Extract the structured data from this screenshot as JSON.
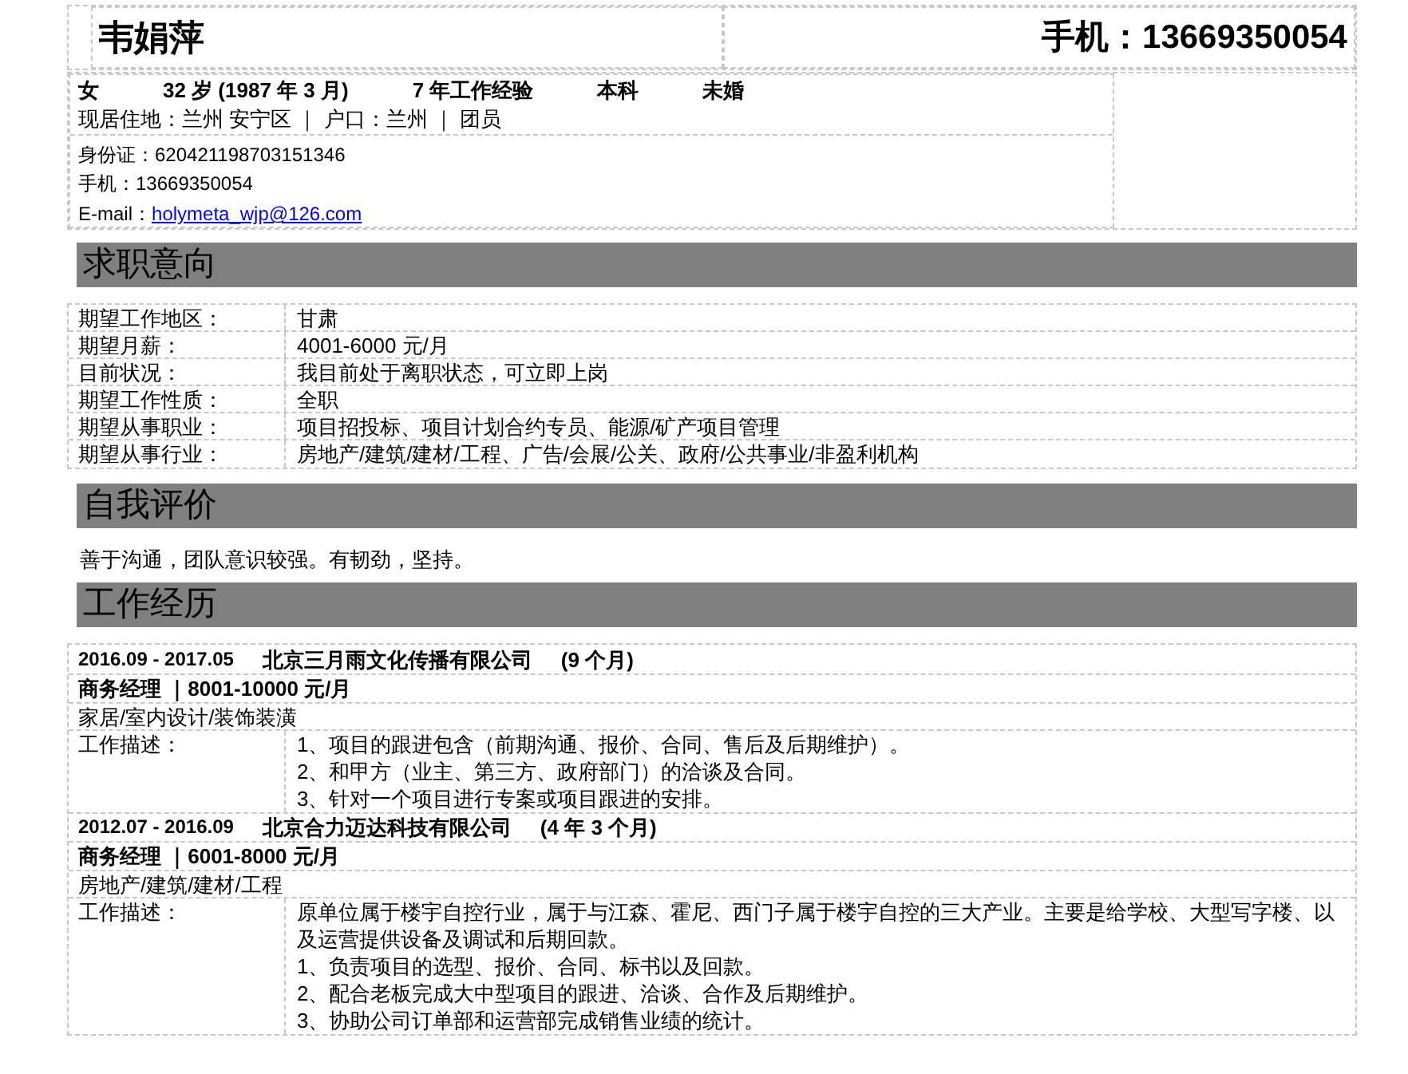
{
  "header": {
    "name": "韦娟萍",
    "phone": "手机：13669350054"
  },
  "profile": {
    "summary": [
      "女",
      "32 岁 (1987 年 3 月)",
      "7 年工作经验",
      "本科",
      "未婚"
    ],
    "residence": "现居住地：兰州 安宁区 ｜ 户口：兰州 ｜ 团员",
    "id_number": "身份证：620421198703151346",
    "mobile": "手机：13669350054",
    "email_label": "E-mail：",
    "email": "holymeta_wjp@126.com"
  },
  "job_intent": {
    "title": "求职意向",
    "rows": [
      {
        "label": "期望工作地区：",
        "value": "甘肃"
      },
      {
        "label": "期望月薪：",
        "value": "4001-6000 元/月"
      },
      {
        "label": "目前状况：",
        "value": "我目前处于离职状态，可立即上岗"
      },
      {
        "label": "期望工作性质：",
        "value": "全职"
      },
      {
        "label": "期望从事职业：",
        "value": "项目招投标、项目计划合约专员、能源/矿产项目管理"
      },
      {
        "label": "期望从事行业：",
        "value": "房地产/建筑/建材/工程、广告/会展/公关、政府/公共事业/非盈利机构"
      }
    ]
  },
  "self_evaluation": {
    "title": "自我评价",
    "text": "善于沟通，团队意识较强。有韧劲，坚持。"
  },
  "work_experience": {
    "title": "工作经历",
    "jobs": [
      {
        "period": "2016.09 - 2017.05",
        "company": "北京三月雨文化传播有限公司",
        "duration": "(9 个月)",
        "position": "商务经理 ｜8001-10000 元/月",
        "industry": "家居/室内设计/装饰装潢",
        "description_label": "工作描述：",
        "description": [
          "1、项目的跟进包含（前期沟通、报价、合同、售后及后期维护）。",
          "2、和甲方（业主、第三方、政府部门）的洽谈及合同。",
          "3、针对一个项目进行专案或项目跟进的安排。"
        ]
      },
      {
        "period": "2012.07 - 2016.09",
        "company": "北京合力迈达科技有限公司",
        "duration": "(4 年  3 个月)",
        "position": "商务经理 ｜6001-8000 元/月",
        "industry": "房地产/建筑/建材/工程",
        "description_label": "工作描述：",
        "description": [
          "原单位属于楼宇自控行业，属于与江森、霍尼、西门子属于楼宇自控的三大产业。主要是给学校、大型写字楼、以及运营提供设备及调试和后期回款。",
          "1、负责项目的选型、报价、合同、标书以及回款。",
          "2、配合老板完成大中型项目的跟进、洽谈、合作及后期维护。",
          "3、协助公司订单部和运营部完成销售业绩的统计。"
        ]
      }
    ]
  }
}
